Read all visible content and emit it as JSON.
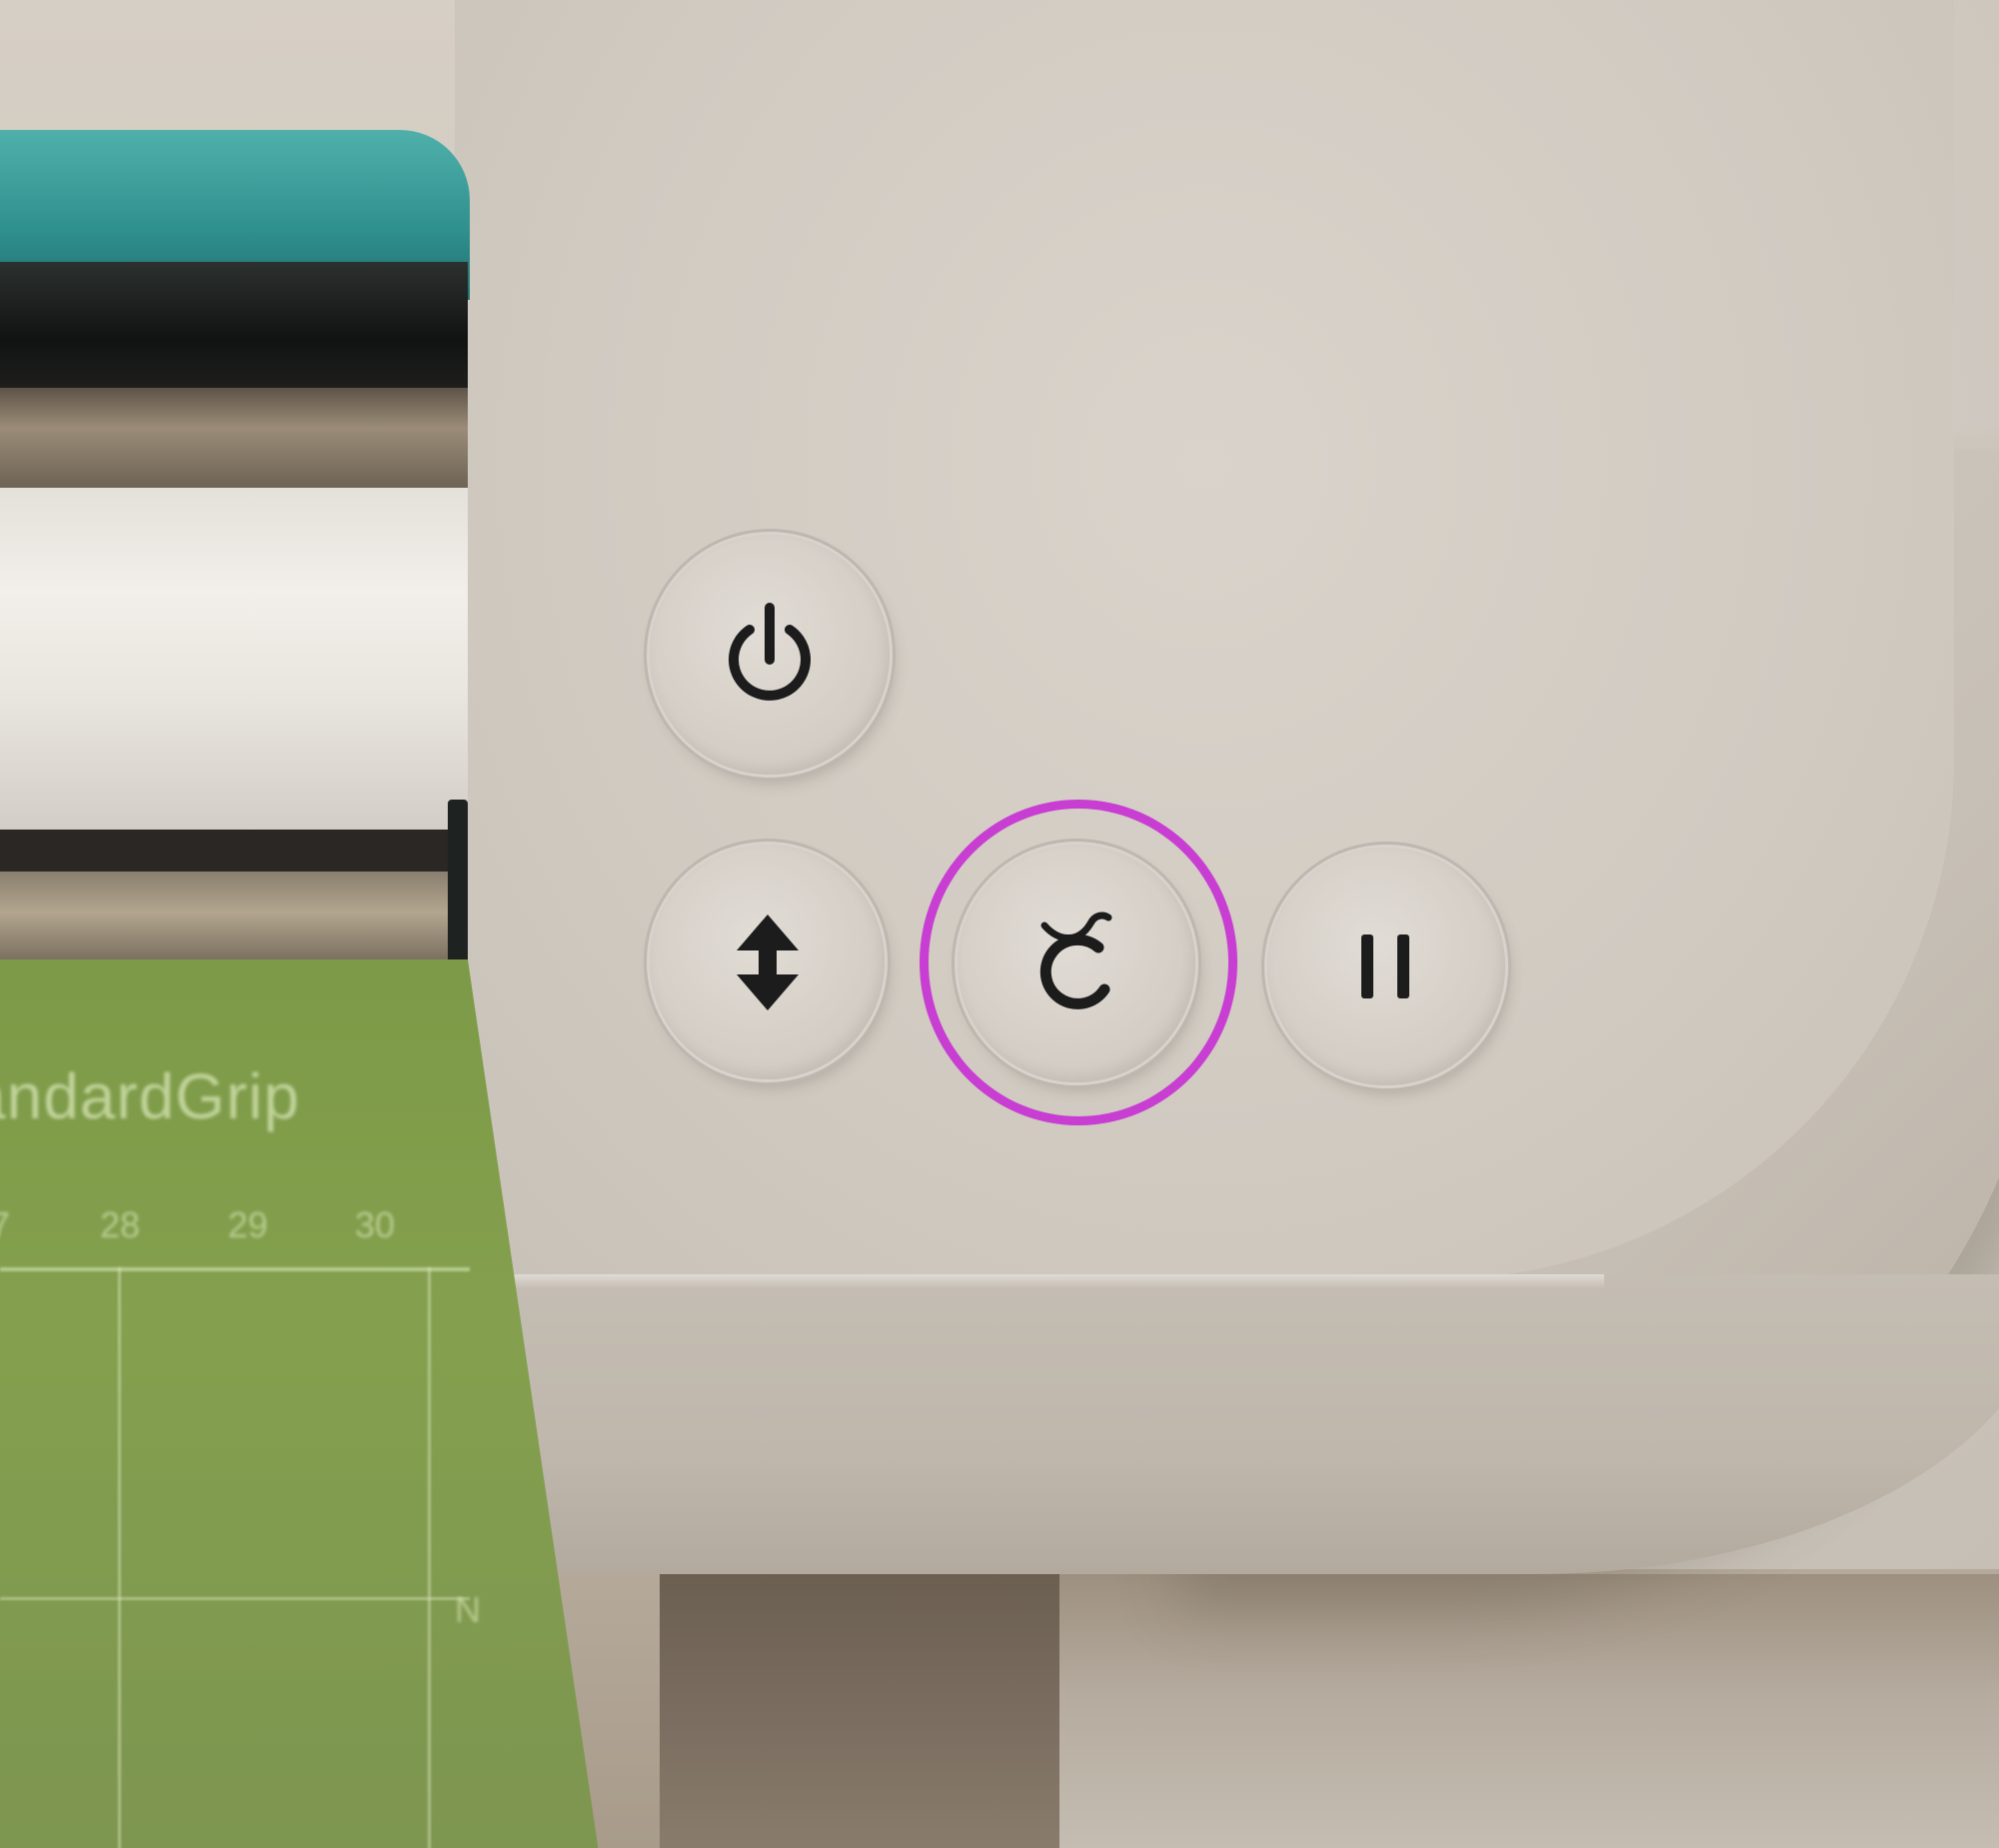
{
  "scene": {
    "mat_label": "andardGrip",
    "mat_ruler_ticks": [
      "7",
      "28",
      "29",
      "30"
    ],
    "mat_side_mark": "N"
  },
  "controls": {
    "buttons": [
      {
        "name": "power-button",
        "icon": "power-icon"
      },
      {
        "name": "load-unload-button",
        "icon": "up-down-arrows-icon"
      },
      {
        "name": "go-button",
        "icon": "cricut-c-icon",
        "highlighted": true
      },
      {
        "name": "pause-button",
        "icon": "pause-icon"
      }
    ]
  },
  "colors": {
    "highlight": "#c83dd2",
    "icon": "#1c1c1c",
    "mat": "#7f9b4c",
    "teal": "#2f8f8d"
  }
}
